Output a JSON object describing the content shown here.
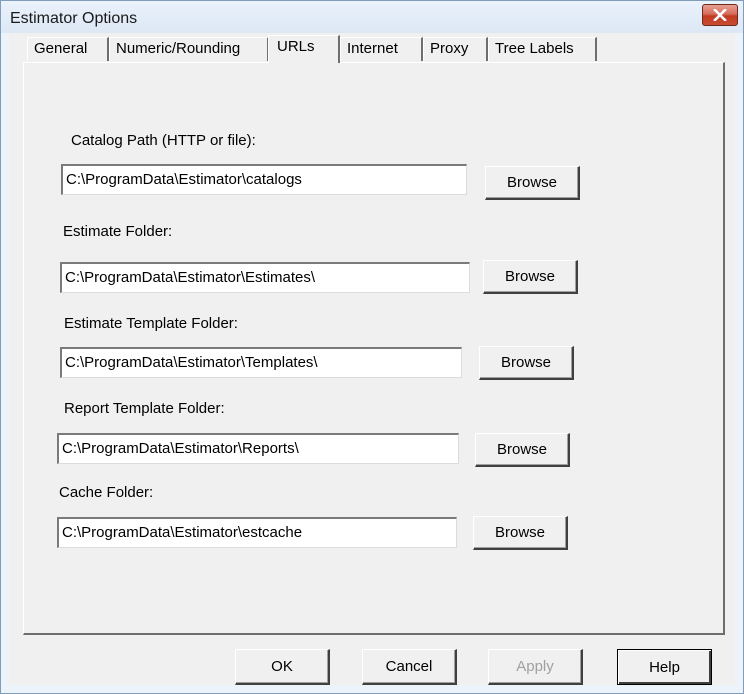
{
  "window": {
    "title": "Estimator Options"
  },
  "tabs": [
    {
      "label": "General",
      "active": false
    },
    {
      "label": "Numeric/Rounding",
      "active": false
    },
    {
      "label": "URLs",
      "active": true
    },
    {
      "label": "Internet",
      "active": false
    },
    {
      "label": "Proxy",
      "active": false
    },
    {
      "label": "Tree Labels",
      "active": false
    }
  ],
  "urls": {
    "catalog_path": {
      "label": "Catalog Path (HTTP or file):",
      "value": "C:\\ProgramData\\Estimator\\catalogs",
      "browse": "Browse"
    },
    "estimate_folder": {
      "label": "Estimate Folder:",
      "value": "C:\\ProgramData\\Estimator\\Estimates\\",
      "browse": "Browse"
    },
    "estimate_template_folder": {
      "label": "Estimate Template Folder:",
      "value": "C:\\ProgramData\\Estimator\\Templates\\",
      "browse": "Browse"
    },
    "report_template_folder": {
      "label": "Report Template Folder:",
      "value": "C:\\ProgramData\\Estimator\\Reports\\",
      "browse": "Browse"
    },
    "cache_folder": {
      "label": "Cache Folder:",
      "value": "C:\\ProgramData\\Estimator\\estcache",
      "browse": "Browse"
    }
  },
  "buttons": {
    "ok": "OK",
    "cancel": "Cancel",
    "apply": "Apply",
    "help": "Help",
    "apply_enabled": false
  },
  "icons": {
    "close": "close-icon"
  },
  "colors": {
    "close_button": "#c74b32",
    "dialog_face": "#f0f0f0",
    "title_bar": "#dde8f5"
  }
}
